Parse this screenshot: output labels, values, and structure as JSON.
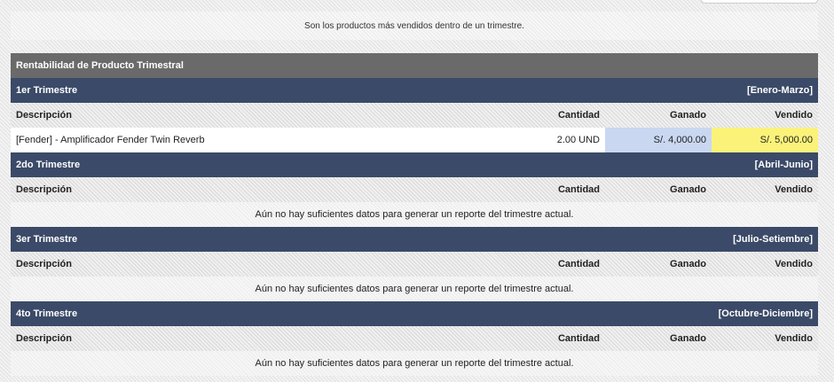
{
  "intro_text": "Son los productos más vendidos dentro de un trimestre.",
  "report_title": "Rentabilidad de Producto Trimestral",
  "columns": {
    "desc": "Descripción",
    "qty": "Cantidad",
    "earned": "Ganado",
    "sold": "Vendido"
  },
  "quarters": [
    {
      "name": "1er Trimestre",
      "range": "[Enero-Marzo]"
    },
    {
      "name": "2do Trimestre",
      "range": "[Abril-Junio]"
    },
    {
      "name": "3er Trimestre",
      "range": "[Julio-Setiembre]"
    },
    {
      "name": "4to Trimestre",
      "range": "[Octubre-Diciembre]"
    }
  ],
  "q1_row": {
    "desc": "[Fender] - Amplificador Fender Twin Reverb",
    "qty": "2.00 UND",
    "earned": "S/. 4,000.00",
    "sold": "S/. 5,000.00"
  },
  "no_data_text": "Aún no hay suficientes datos para generar un reporte del trimestre actual.",
  "colors": {
    "header_gray": "#6a6a6a",
    "header_navy": "#3b4a68",
    "earned_bg": "#c9d7f1",
    "sold_bg": "#fbf27a"
  }
}
